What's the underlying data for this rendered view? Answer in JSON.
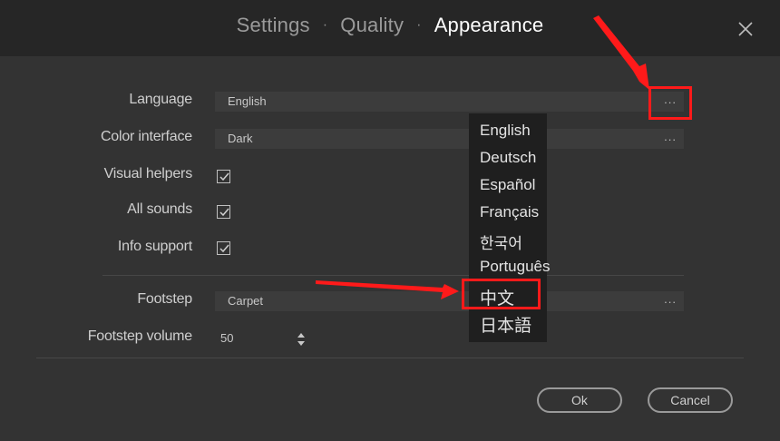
{
  "header": {
    "tabs": [
      "Settings",
      "Quality",
      "Appearance"
    ],
    "separator": "·",
    "active_tab": "Appearance"
  },
  "settings": {
    "language": {
      "label": "Language",
      "value": "English",
      "more": "..."
    },
    "color_interface": {
      "label": "Color interface",
      "value": "Dark",
      "more": "..."
    },
    "visual_helpers": {
      "label": "Visual helpers",
      "checked": true
    },
    "all_sounds": {
      "label": "All sounds",
      "checked": true
    },
    "info_support": {
      "label": "Info support",
      "checked": true
    },
    "footstep": {
      "label": "Footstep",
      "value": "Carpet",
      "more": "..."
    },
    "footstep_volume": {
      "label": "Footstep volume",
      "value": "50"
    }
  },
  "language_dropdown": {
    "options": [
      "English",
      "Deutsch",
      "Español",
      "Français",
      "한국어",
      "Português",
      "中文",
      "日本語"
    ],
    "highlighted": "中文"
  },
  "buttons": {
    "ok": "Ok",
    "cancel": "Cancel"
  },
  "annotations": {
    "color": "#ff1a1a"
  },
  "icons": [
    "close-icon",
    "checkmark-icon",
    "stepper-arrows-icon",
    "more-dots-icon"
  ]
}
